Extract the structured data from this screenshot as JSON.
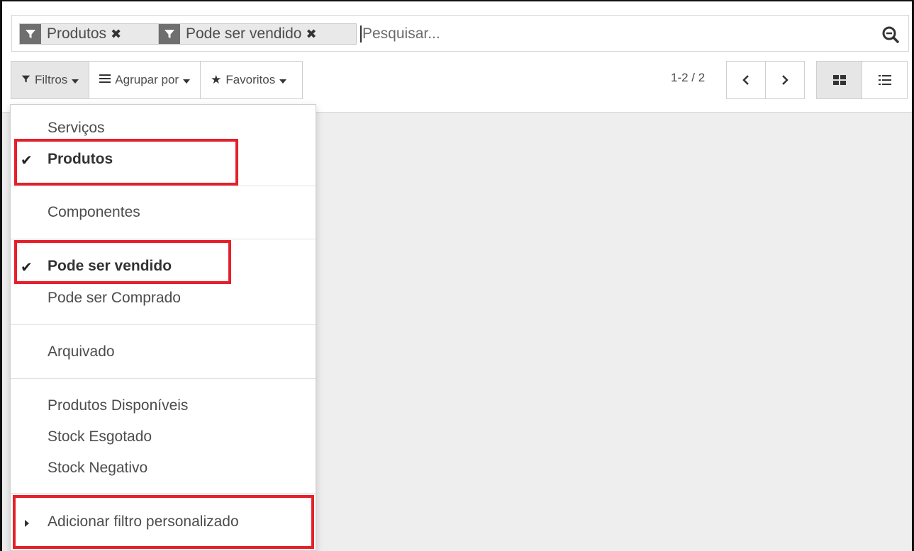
{
  "search": {
    "facets": [
      {
        "label": "Produtos"
      },
      {
        "label": "Pode ser vendido"
      }
    ],
    "placeholder": "Pesquisar..."
  },
  "toolbar": {
    "filters_label": "Filtros",
    "groupby_label": "Agrupar por",
    "favorites_label": "Favoritos"
  },
  "pager": {
    "value": "1-2 / 2"
  },
  "filters_menu": {
    "items": [
      {
        "label": "Serviços",
        "checked": false
      },
      {
        "label": "Produtos",
        "checked": true
      },
      {
        "label": "Componentes",
        "checked": false
      },
      {
        "label": "Pode ser vendido",
        "checked": true
      },
      {
        "label": "Pode ser Comprado",
        "checked": false
      },
      {
        "label": "Arquivado",
        "checked": false
      },
      {
        "label": "Produtos Disponíveis",
        "checked": false
      },
      {
        "label": "Stock Esgotado",
        "checked": false
      },
      {
        "label": "Stock Negativo",
        "checked": false
      }
    ],
    "custom_filter_label": "Adicionar filtro personalizado"
  },
  "colors": {
    "highlight": "#e5202a",
    "background": "#efeeee",
    "facet_icon": "#6f6f6f"
  }
}
